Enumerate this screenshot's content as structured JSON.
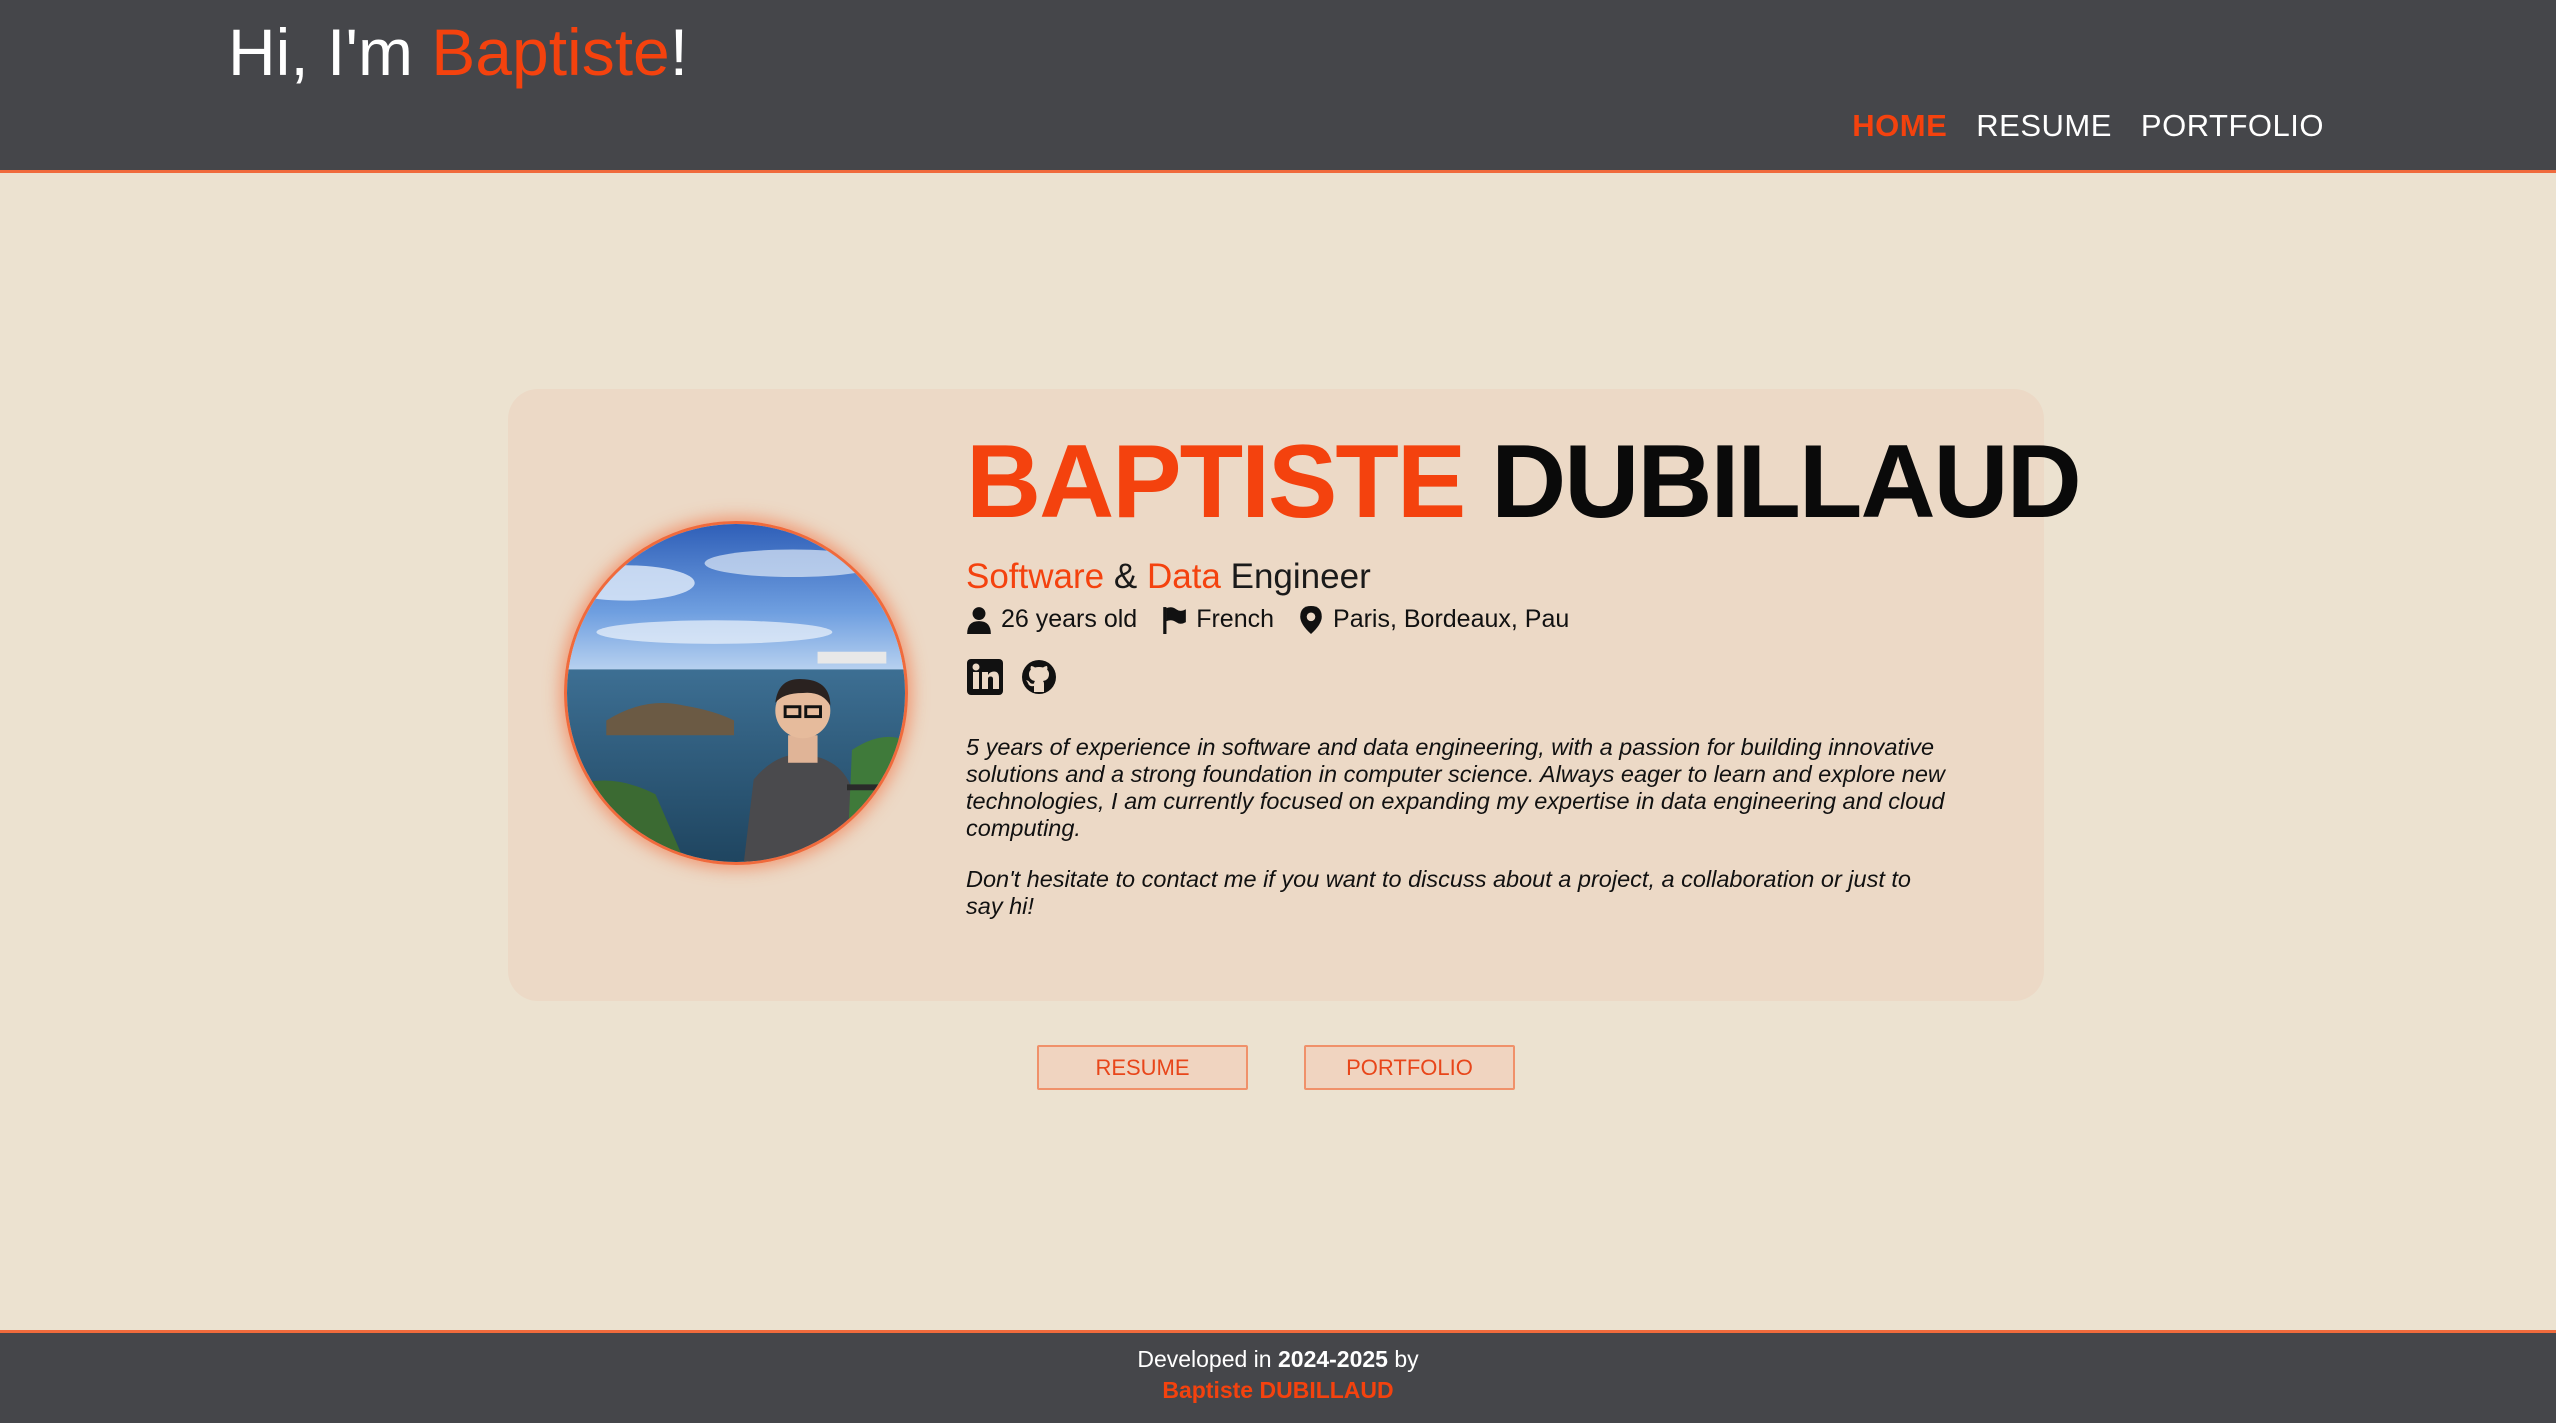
{
  "header": {
    "greeting_prefix": "Hi, I'm ",
    "greeting_name": "Baptiste",
    "greeting_suffix": "!",
    "nav": [
      {
        "label": "HOME",
        "active": true
      },
      {
        "label": "RESUME",
        "active": false
      },
      {
        "label": "PORTFOLIO",
        "active": false
      }
    ]
  },
  "profile": {
    "first_name": "BAPTISTE",
    "last_name": "DUBILLAUD",
    "role_word1": "Software",
    "role_amp": "&",
    "role_word2": "Data",
    "role_word3": "Engineer",
    "age": "26 years old",
    "nationality": "French",
    "locations": "Paris, Bordeaux, Pau",
    "socials": [
      {
        "name": "LinkedIn",
        "icon": "linkedin-icon"
      },
      {
        "name": "GitHub",
        "icon": "github-icon"
      }
    ],
    "bio_1": "5 years of experience in software and data engineering, with a passion for building innovative solutions and a strong foundation in computer science. Always eager to learn and explore new technologies, I am currently focused on expanding my expertise in data engineering and cloud computing.",
    "bio_2": "Don't hesitate to contact me if you want to discuss about a project, a collaboration or just to say hi!"
  },
  "buttons": {
    "resume": "RESUME",
    "portfolio": "PORTFOLIO"
  },
  "footer": {
    "prefix": "Developed in ",
    "years": "2024-2025",
    "suffix": " by",
    "author": "Baptiste DUBILLAUD"
  },
  "colors": {
    "accent": "#f4420e",
    "header_bg": "#45464a",
    "page_bg": "#ece2d0",
    "card_bg": "#ecd9c6"
  }
}
